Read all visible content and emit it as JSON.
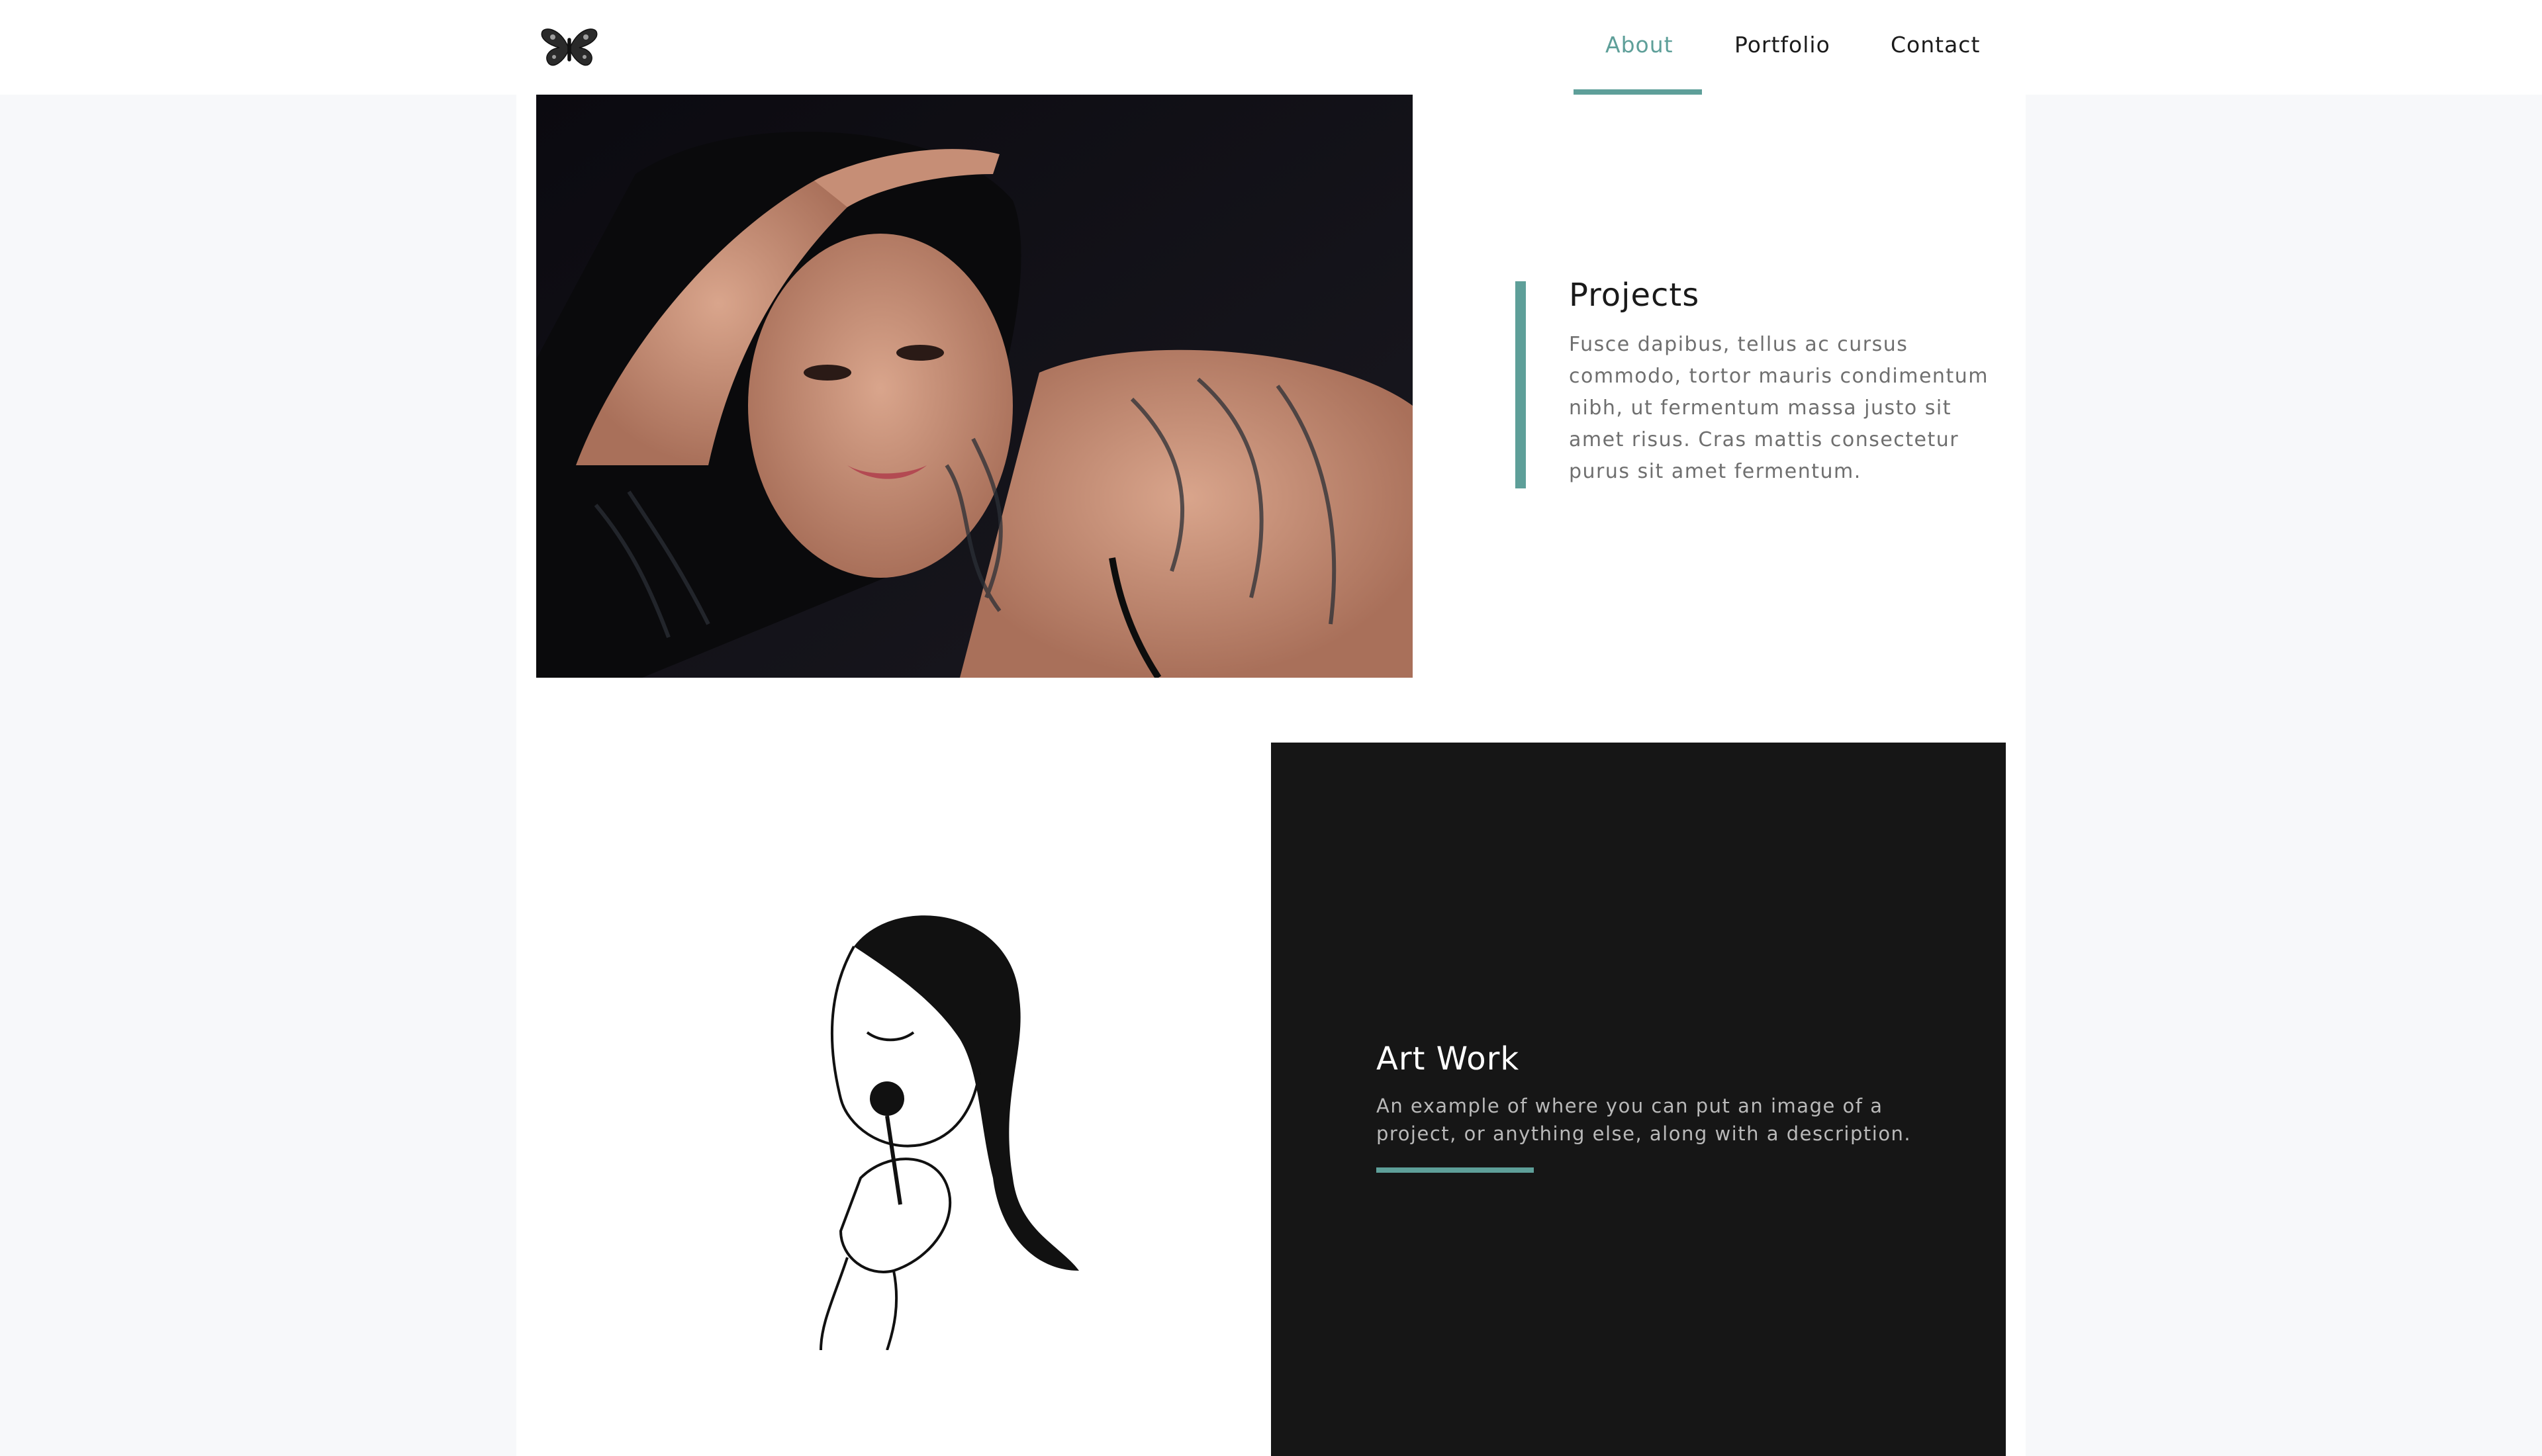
{
  "nav": {
    "logo_icon": "butterfly-icon",
    "items": [
      {
        "label": "About",
        "active": true
      },
      {
        "label": "Portfolio",
        "active": false
      },
      {
        "label": "Contact",
        "active": false
      }
    ]
  },
  "projects": {
    "title": "Projects",
    "text": "Fusce dapibus, tellus ac cursus commodo, tortor mauris condimentum nibh, ut fermentum massa justo sit amet risus. Cras mattis consectetur purus sit amet fermentum."
  },
  "artwork": {
    "title": "Art Work",
    "text": "An example of where you can put an image of a project, or anything else, along with a description."
  },
  "colors": {
    "accent": "#5e9f99",
    "background": "#f7f8fa",
    "dark_card": "#161616"
  }
}
